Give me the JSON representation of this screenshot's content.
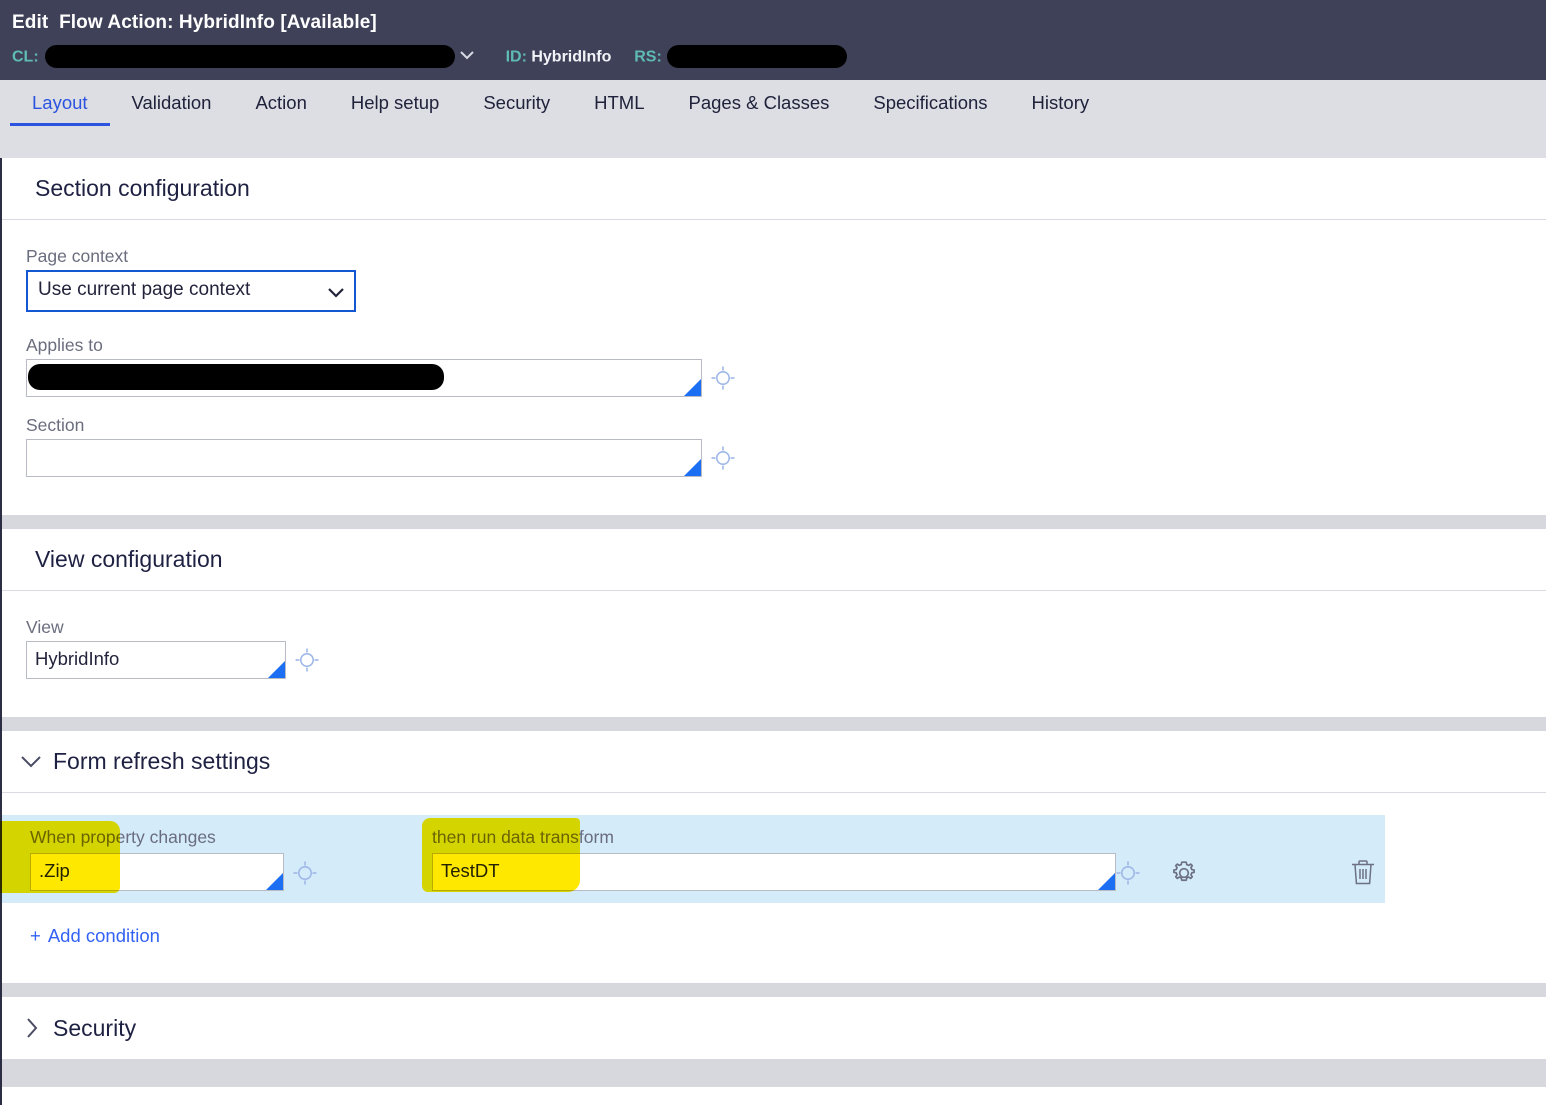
{
  "header": {
    "title_prefix": "Edit",
    "title_main": "Flow Action: HybridInfo",
    "title_status": "[Available]",
    "cl_key": "CL:",
    "cl_value": "",
    "id_key": "ID:",
    "id_value": "HybridInfo",
    "rs_key": "RS:",
    "rs_value": "",
    "bg_color": "#3f4159",
    "key_color": "#5fbcb4"
  },
  "tabs": [
    {
      "label": "Layout",
      "active": true
    },
    {
      "label": "Validation",
      "active": false
    },
    {
      "label": "Action",
      "active": false
    },
    {
      "label": "Help setup",
      "active": false
    },
    {
      "label": "Security",
      "active": false
    },
    {
      "label": "HTML",
      "active": false
    },
    {
      "label": "Pages & Classes",
      "active": false
    },
    {
      "label": "Specifications",
      "active": false
    },
    {
      "label": "History",
      "active": false
    }
  ],
  "section_configuration": {
    "title": "Section configuration",
    "page_context": {
      "label": "Page context",
      "selected": "Use current page context",
      "options": [
        "Use current page context"
      ],
      "focus_border_color": "#1457d3"
    },
    "applies_to": {
      "label": "Applies to",
      "value": "",
      "icon": "crosshair-icon"
    },
    "section": {
      "label": "Section",
      "value": "",
      "icon": "crosshair-icon"
    }
  },
  "view_configuration": {
    "title": "View configuration",
    "view": {
      "label": "View",
      "value": "HybridInfo",
      "icon": "crosshair-icon"
    }
  },
  "form_refresh_settings": {
    "title": "Form refresh settings",
    "expanded": true,
    "caret": "chevron-down-icon",
    "columns": {
      "when_property_changes": "When property changes",
      "then_run_data_transform": "then run data transform"
    },
    "conditions": [
      {
        "property": ".Zip",
        "data_transform": "TestDT",
        "gear": "gear-icon",
        "delete": "trash-icon"
      }
    ],
    "add_condition_label": "Add condition",
    "add_condition_plus": "+",
    "row_bg_color": "#d4ebfa",
    "highlight_color": "#ffe800"
  },
  "security_section": {
    "title": "Security",
    "expanded": false,
    "caret": "chevron-right-icon"
  }
}
